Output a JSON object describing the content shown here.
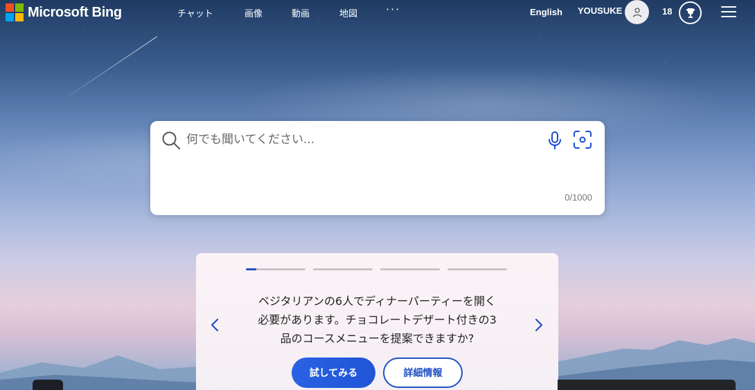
{
  "header": {
    "logo_text": "Microsoft Bing",
    "logo_colors": [
      "#f25022",
      "#7fba00",
      "#00a4ef",
      "#ffb900"
    ],
    "nav": [
      {
        "label": "チャット"
      },
      {
        "label": "画像"
      },
      {
        "label": "動画"
      },
      {
        "label": "地図"
      }
    ],
    "more_label": "···",
    "language_label": "English",
    "user_name": "YOUSUKE",
    "rewards_points": "18",
    "avatar_icon": "person-icon",
    "rewards_icon": "trophy-icon",
    "menu_icon": "hamburger-icon"
  },
  "search": {
    "placeholder": "何でも聞いてください...",
    "value": "",
    "char_counter": "0/1000",
    "search_icon": "search-icon",
    "mic_icon": "microphone-icon",
    "visual_search_icon": "visual-search-icon"
  },
  "suggestion": {
    "progress_steps": 4,
    "active_step": 1,
    "active_step_progress": 0.18,
    "text_lines": [
      "ベジタリアンの6人でディナーパーティーを開く",
      "必要があります。チョコレートデザート付きの3",
      "品のコースメニューを提案できますか?"
    ],
    "try_button_label": "試してみる",
    "details_button_label": "詳細情報",
    "prev_icon": "chevron-left-icon",
    "next_icon": "chevron-right-icon"
  },
  "colors": {
    "accent": "#1f55d6",
    "icon_blue": "#1a4bd0"
  }
}
